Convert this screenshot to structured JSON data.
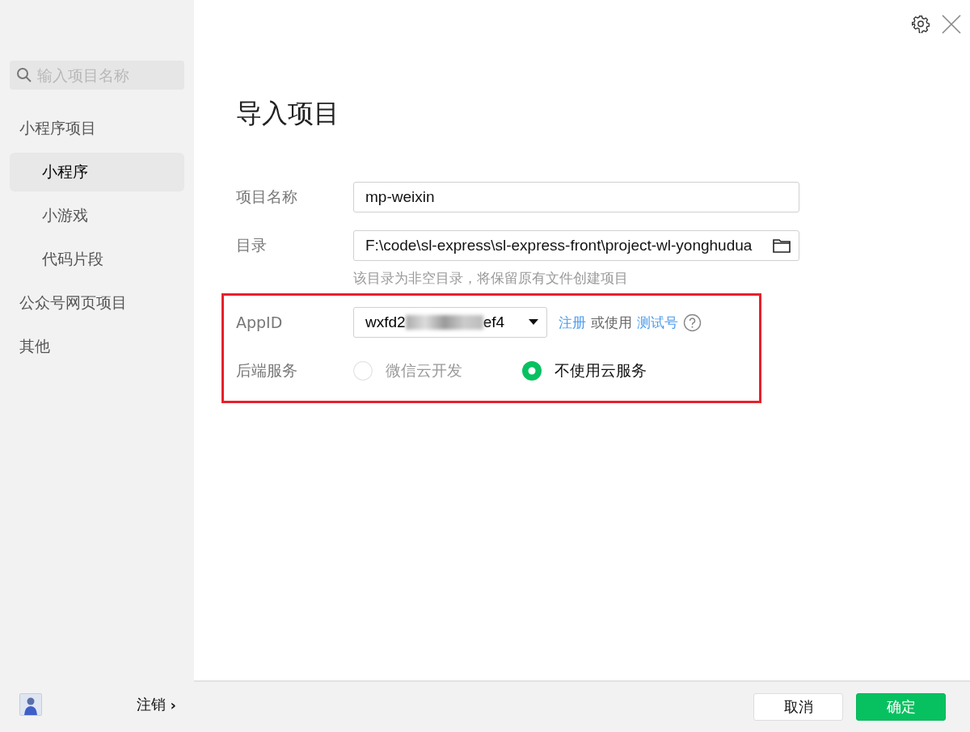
{
  "sidebar": {
    "search": {
      "placeholder": "输入项目名称"
    },
    "items": [
      {
        "label": "小程序项目",
        "selected": false,
        "children": [
          {
            "label": "小程序",
            "selected": true
          },
          {
            "label": "小游戏",
            "selected": false
          },
          {
            "label": "代码片段",
            "selected": false
          }
        ]
      },
      {
        "label": "公众号网页项目",
        "selected": false
      },
      {
        "label": "其他",
        "selected": false
      }
    ],
    "logout": "注销",
    "logout_arrow": "›"
  },
  "dialog": {
    "title": "导入项目",
    "fields": [
      {
        "label": "项目名称",
        "value": "mp-weixin"
      },
      {
        "label": "目录",
        "value": "F:\\code\\sl-express\\sl-express-front\\project-wl-yonghudua",
        "hint": "该目录为非空目录，将保留原有文件创建项目"
      }
    ],
    "appid": {
      "label": "AppID",
      "value_start": "wxfd2",
      "value_end": "ef4",
      "register": "注册",
      "or_use": "或使用",
      "test_account": "测试号"
    },
    "backend": {
      "label": "后端服务",
      "options": [
        {
          "label": "微信云开发",
          "selected": false,
          "disabled": true
        },
        {
          "label": "不使用云服务",
          "selected": true,
          "disabled": false
        }
      ]
    }
  },
  "footer": {
    "buttons": [
      {
        "label": "取消",
        "kind": "secondary"
      },
      {
        "label": "确定",
        "kind": "primary"
      }
    ]
  }
}
